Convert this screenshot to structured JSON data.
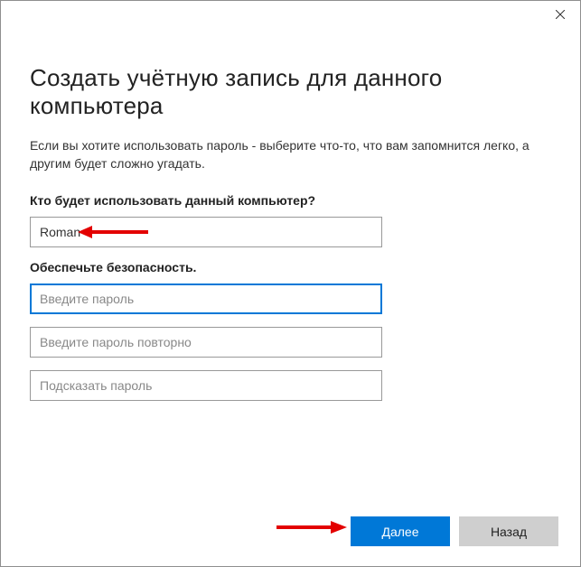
{
  "title": "Создать учётную запись для данного компьютера",
  "description": "Если вы хотите использовать пароль - выберите что-то, что вам запомнится легко, а другим будет сложно угадать.",
  "section_who_label": "Кто будет использовать данный компьютер?",
  "username_value": "Roman",
  "section_security_label": "Обеспечьте безопасность.",
  "password_placeholder": "Введите пароль",
  "password_confirm_placeholder": "Введите пароль повторно",
  "password_hint_placeholder": "Подсказать пароль",
  "buttons": {
    "next": "Далее",
    "back": "Назад"
  }
}
